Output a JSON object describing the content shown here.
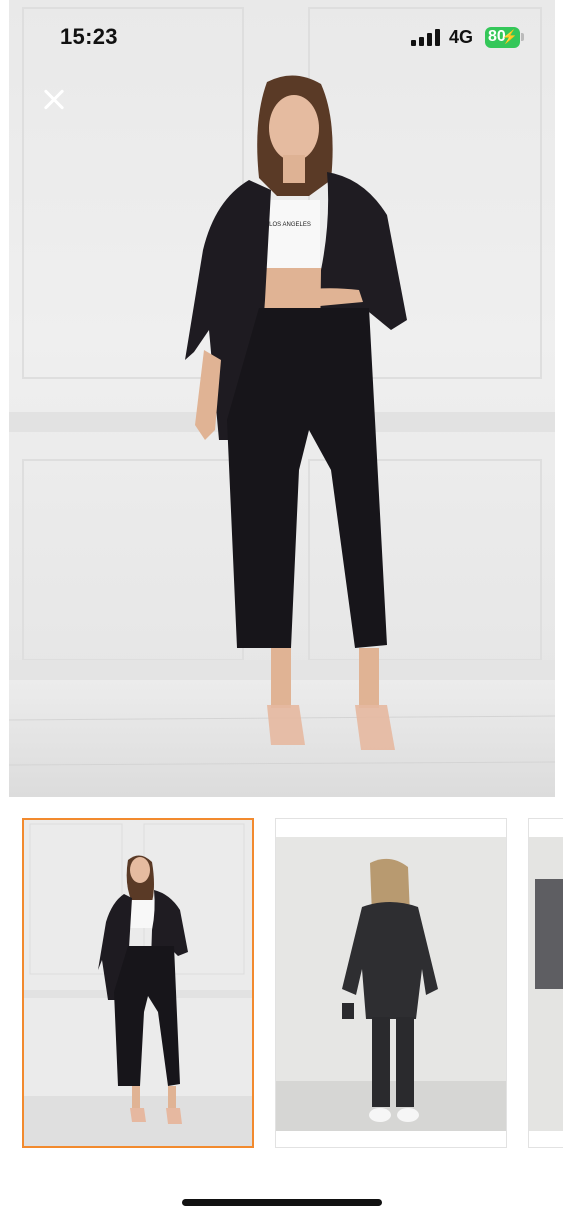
{
  "status_bar": {
    "time": "15:23",
    "network": "4G",
    "battery": "80",
    "battery_color": "#34c759"
  },
  "main_image": {
    "icon": "close-icon",
    "top_text": "LOS ANGELES"
  },
  "thumbnails": [
    {
      "selected": true,
      "accent": "#f28a2e"
    },
    {
      "selected": false
    },
    {
      "selected": false
    }
  ]
}
